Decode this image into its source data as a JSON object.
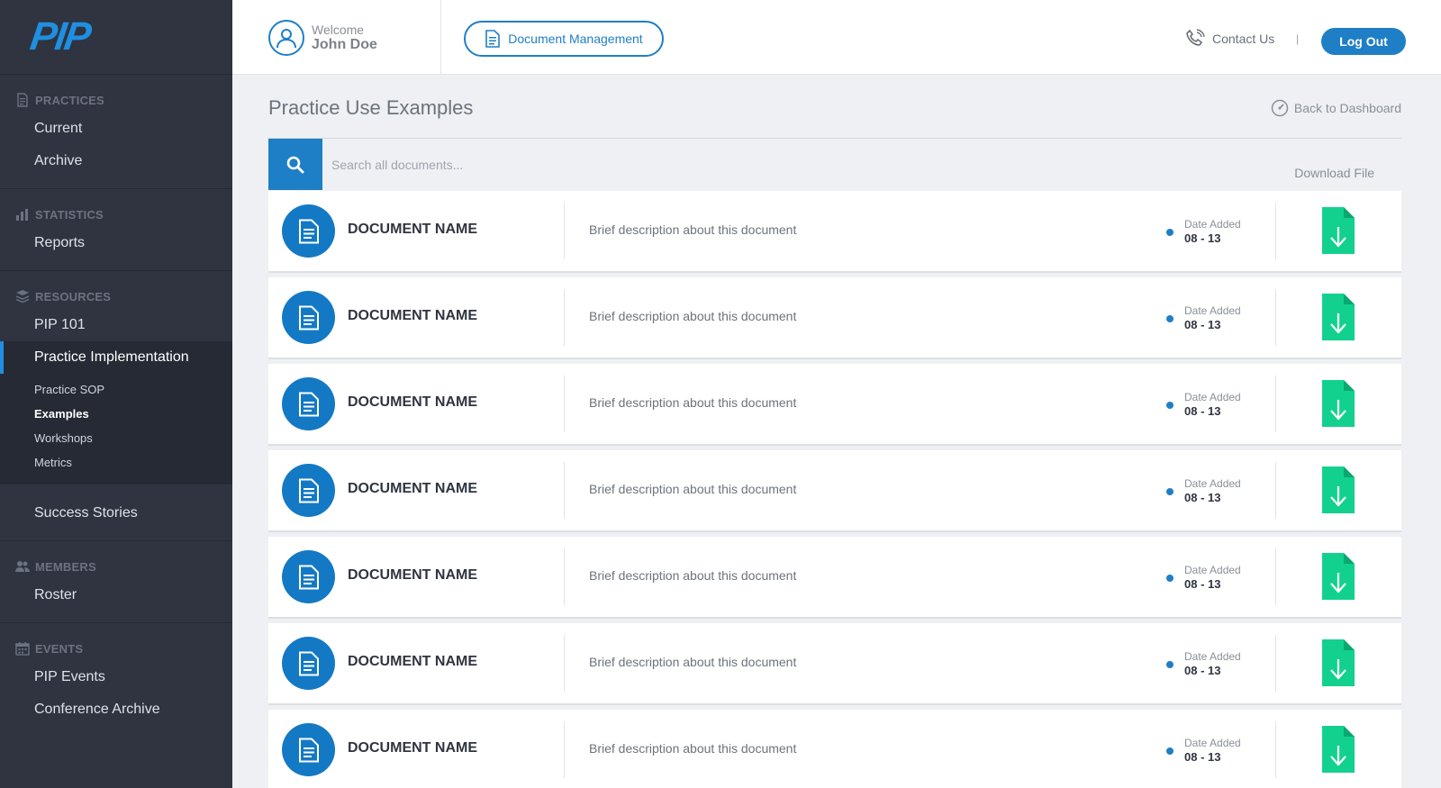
{
  "brand": {
    "logo_text": "PIP",
    "accent": "#1f7fc6",
    "download_color": "#12d18e"
  },
  "sidebar": {
    "sections": [
      {
        "heading": "PRACTICES",
        "icon": "document-icon",
        "items": [
          "Current",
          "Archive"
        ]
      },
      {
        "heading": "STATISTICS",
        "icon": "bar-chart-icon",
        "items": [
          "Reports"
        ]
      },
      {
        "heading": "RESOURCES",
        "icon": "stack-icon",
        "items": [
          "PIP 101",
          "Practice Implementation"
        ],
        "active": "Practice Implementation",
        "subitems": [
          "Practice SOP",
          "Examples",
          "Workshops",
          "Metrics"
        ],
        "current_subitem": "Examples"
      },
      {
        "heading": "",
        "items": [
          "Success Stories"
        ]
      },
      {
        "heading": "MEMBERS",
        "icon": "users-icon",
        "items": [
          "Roster"
        ]
      },
      {
        "heading": "EVENTS",
        "icon": "calendar-icon",
        "items": [
          "PIP Events",
          "Conference Archive"
        ]
      }
    ]
  },
  "header": {
    "welcome_label": "Welcome",
    "user_name": "John Doe",
    "doc_mgmt_label": "Document Management",
    "contact_label": "Contact Us",
    "separator": "|",
    "logout_label": "Log Out"
  },
  "main": {
    "title": "Practice Use Examples",
    "back_label": "Back to Dashboard",
    "search_placeholder": "Search all documents...",
    "download_header": "Download File",
    "documents": [
      {
        "name": "DOCUMENT NAME",
        "description": "Brief description about this document",
        "date_label": "Date Added",
        "date": "08 - 13"
      },
      {
        "name": "DOCUMENT NAME",
        "description": "Brief description about this document",
        "date_label": "Date Added",
        "date": "08 - 13"
      },
      {
        "name": "DOCUMENT NAME",
        "description": "Brief description about this document",
        "date_label": "Date Added",
        "date": "08 - 13"
      },
      {
        "name": "DOCUMENT NAME",
        "description": "Brief description about this document",
        "date_label": "Date Added",
        "date": "08 - 13"
      },
      {
        "name": "DOCUMENT NAME",
        "description": "Brief description about this document",
        "date_label": "Date Added",
        "date": "08 - 13"
      },
      {
        "name": "DOCUMENT NAME",
        "description": "Brief description about this document",
        "date_label": "Date Added",
        "date": "08 - 13"
      },
      {
        "name": "DOCUMENT NAME",
        "description": "Brief description about this document",
        "date_label": "Date Added",
        "date": "08 - 13"
      }
    ]
  }
}
